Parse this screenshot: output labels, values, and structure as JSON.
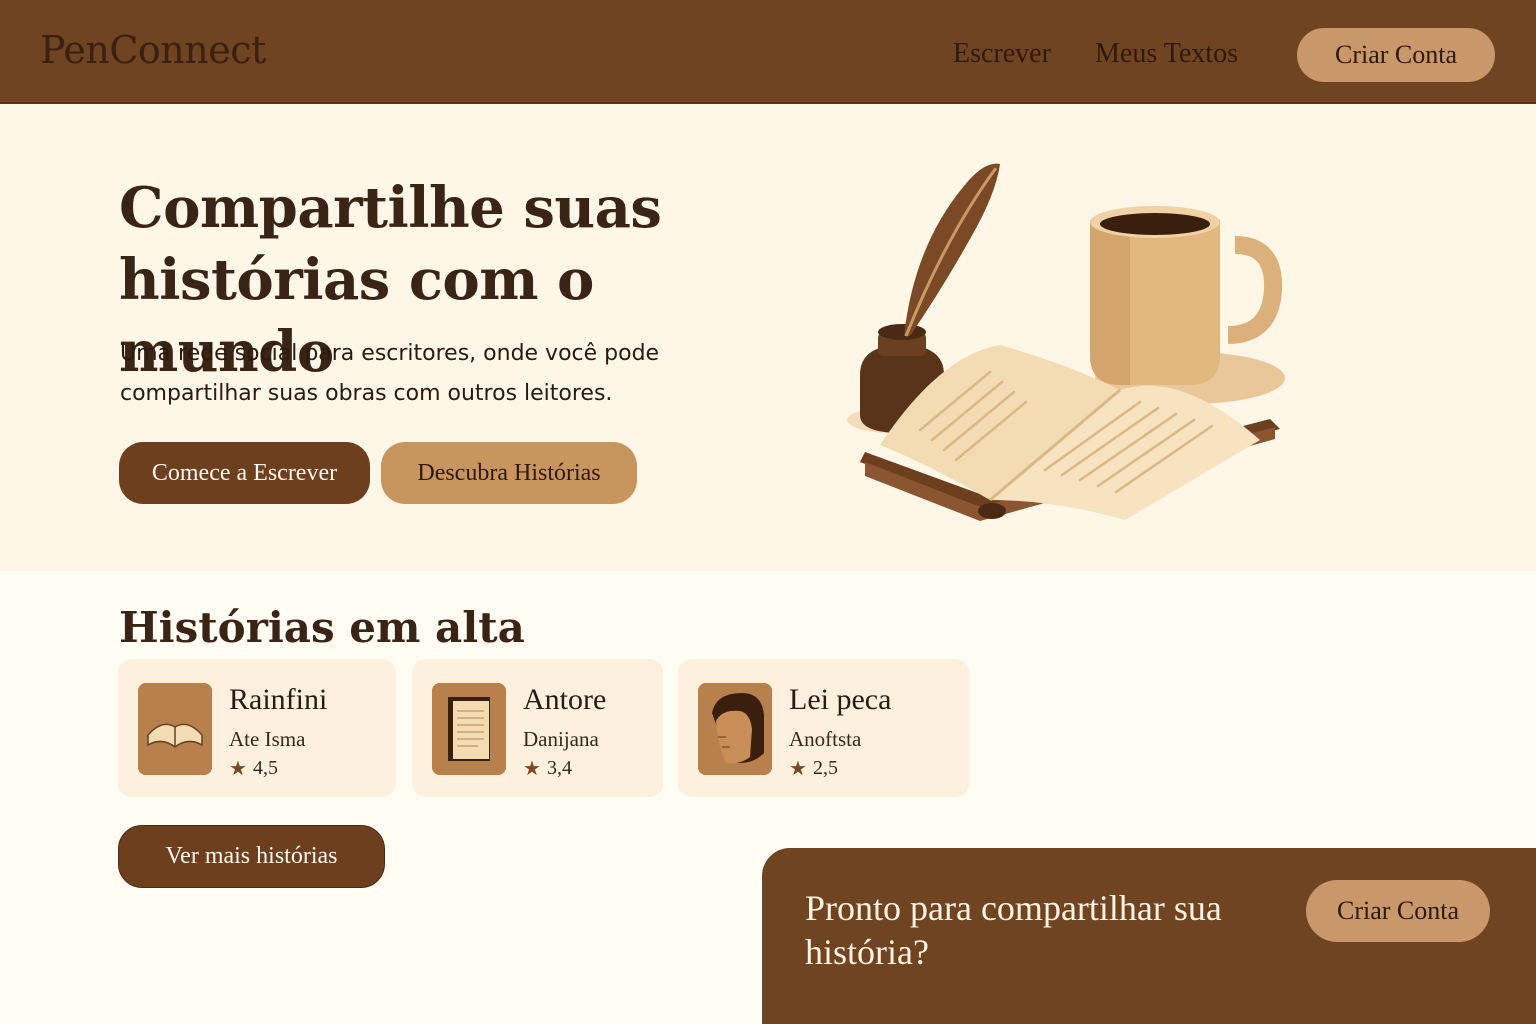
{
  "header": {
    "logo": "PenConnect",
    "nav": [
      {
        "label": "Escrever"
      },
      {
        "label": "Meus Textos"
      }
    ],
    "signup_label": "Criar Conta"
  },
  "hero": {
    "title": "Compartilhe suas histórias com o mundo",
    "subtitle": "Uma rede social para escritores, onde você pode compartilhar suas obras com outros leitores.",
    "primary_button": "Comece a Escrever",
    "secondary_button": "Descubra Histórias",
    "illustration_icons": [
      "quill-pen-icon",
      "inkwell-icon",
      "open-book-icon",
      "coffee-mug-icon"
    ]
  },
  "trending": {
    "title": "Histórias em alta",
    "stories": [
      {
        "title": "Rainfini",
        "author": "Ate Isma",
        "rating": "4,5",
        "cover_icon": "open-book-icon"
      },
      {
        "title": "Antore",
        "author": "Danijana",
        "rating": "3,4",
        "cover_icon": "book-page-icon"
      },
      {
        "title": "Lei peca",
        "author": "Anoftsta",
        "rating": "2,5",
        "cover_icon": "portrait-icon"
      }
    ],
    "more_button": "Ver mais histórias"
  },
  "cta": {
    "text": "Pronto para compartilhar sua história?",
    "button": "Criar Conta"
  },
  "colors": {
    "header_bg": "#704321",
    "hero_bg": "#fef6e6",
    "page_bg": "#fffcf3",
    "primary_button": "#6d3f1e",
    "secondary_button": "#c9955f",
    "card_bg": "#fdf0dc",
    "text_dark": "#3a2416"
  }
}
